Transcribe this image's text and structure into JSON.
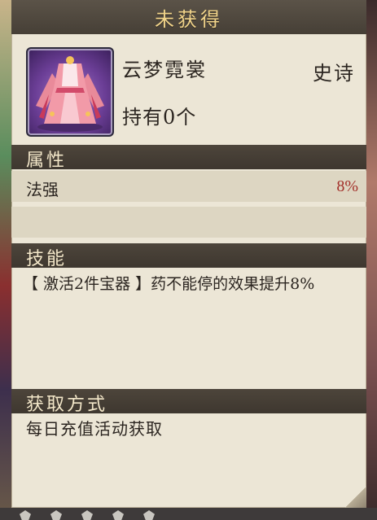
{
  "title": "未获得",
  "item": {
    "name": "云梦霓裳",
    "rarity": "史诗",
    "owned": "持有0个",
    "icon": "costume-dress-icon"
  },
  "sections": {
    "attributes": "属性",
    "skills": "技能",
    "acquire": "获取方式"
  },
  "stats": [
    {
      "name": "法强",
      "value": "8%"
    }
  ],
  "skill": "【 激活2件宝器 】药不能停的效果提升8%",
  "acquire_text": "每日充值活动获取",
  "colors": {
    "title": "#f1d48a",
    "stat_value": "#a3302a",
    "header_bg": "#463f36",
    "panel_bg": "#ece6d6"
  }
}
